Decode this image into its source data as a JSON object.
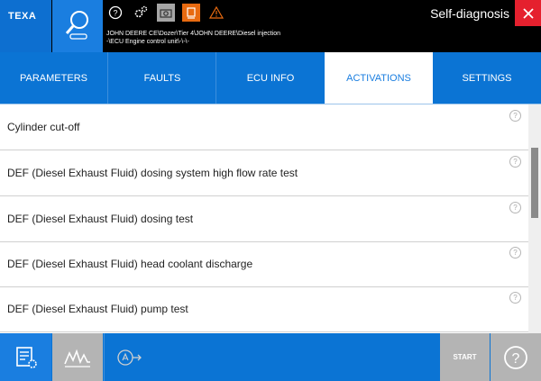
{
  "header": {
    "logo": "TEXA",
    "title": "Self-diagnosis",
    "breadcrumb_line1": "JOHN DEERE CE\\Dozer\\Tier 4\\JOHN DEERE\\Diesel injection",
    "breadcrumb_line2": "-\\ECU Engine control unit\\-\\-\\-",
    "accent_color": "#0b74d4",
    "close_color": "#e5202e",
    "warning_color": "#e86a10"
  },
  "tabs": [
    {
      "label": "PARAMETERS",
      "active": false
    },
    {
      "label": "FAULTS",
      "active": false
    },
    {
      "label": "ECU INFO",
      "active": false
    },
    {
      "label": "ACTIVATIONS",
      "active": true
    },
    {
      "label": "SETTINGS",
      "active": false
    }
  ],
  "activations": [
    {
      "label": "Cylinder cut-off",
      "help": "?"
    },
    {
      "label": "DEF (Diesel Exhaust Fluid) dosing system high flow rate test",
      "help": "?"
    },
    {
      "label": "DEF (Diesel Exhaust Fluid) dosing test",
      "help": "?"
    },
    {
      "label": "DEF (Diesel Exhaust Fluid) head coolant discharge",
      "help": "?"
    },
    {
      "label": "DEF (Diesel Exhaust Fluid) pump test",
      "help": "?"
    }
  ],
  "footer": {
    "start_label": "START",
    "help_label": "?"
  }
}
